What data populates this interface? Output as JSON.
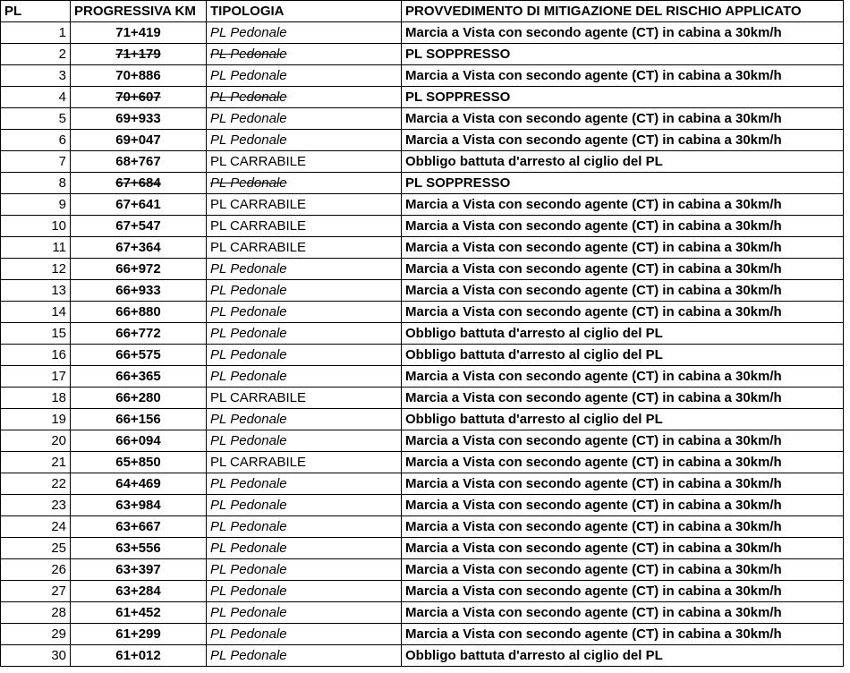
{
  "headers": {
    "pl": "PL",
    "km": "PROGRESSIVA KM",
    "tipologia": "TIPOLOGIA",
    "provvedimento": "PROVVEDIMENTO DI MITIGAZIONE DEL RISCHIO APPLICATO"
  },
  "colors": {
    "marcia": "#4472c4",
    "obbligo": "#ff0000",
    "soppresso": "#00a14b"
  },
  "rows": [
    {
      "pl": "1",
      "km": "71+419",
      "tip": "PL  Pedonale",
      "prov": "Marcia a Vista con secondo agente (CT) in cabina a 30km/h",
      "status": "marcia"
    },
    {
      "pl": "2",
      "km": "71+179",
      "tip": "PL  Pedonale",
      "prov": "PL  SOPPRESSO",
      "status": "soppresso"
    },
    {
      "pl": "3",
      "km": "70+886",
      "tip": "PL  Pedonale",
      "prov": "Marcia a Vista con secondo agente (CT) in cabina a 30km/h",
      "status": "marcia"
    },
    {
      "pl": "4",
      "km": "70+607",
      "tip": "PL  Pedonale",
      "prov": "PL  SOPPRESSO",
      "status": "soppresso"
    },
    {
      "pl": "5",
      "km": "69+933",
      "tip": "PL  Pedonale",
      "prov": "Marcia a Vista con secondo agente (CT) in cabina a 30km/h",
      "status": "marcia"
    },
    {
      "pl": "6",
      "km": "69+047",
      "tip": "PL  Pedonale",
      "prov": "Marcia a Vista con secondo agente (CT) in cabina a 30km/h",
      "status": "marcia"
    },
    {
      "pl": "7",
      "km": "68+767",
      "tip": "PL  CARRABILE",
      "prov": "Obbligo battuta d'arresto al ciglio del PL",
      "status": "obbligo"
    },
    {
      "pl": "8",
      "km": "67+684",
      "tip": "PL  Pedonale",
      "prov": "PL  SOPPRESSO",
      "status": "soppresso"
    },
    {
      "pl": "9",
      "km": "67+641",
      "tip": "PL  CARRABILE",
      "prov": "Marcia a Vista con secondo agente (CT) in cabina a 30km/h",
      "status": "marcia"
    },
    {
      "pl": "10",
      "km": "67+547",
      "tip": "PL  CARRABILE",
      "prov": "Marcia a Vista con secondo agente (CT) in cabina a 30km/h",
      "status": "marcia"
    },
    {
      "pl": "11",
      "km": "67+364",
      "tip": "PL  CARRABILE",
      "prov": "Marcia a Vista con secondo agente (CT) in cabina a 30km/h",
      "status": "marcia"
    },
    {
      "pl": "12",
      "km": "66+972",
      "tip": "PL  Pedonale",
      "prov": "Marcia a Vista con secondo agente (CT) in cabina a 30km/h",
      "status": "marcia"
    },
    {
      "pl": "13",
      "km": "66+933",
      "tip": "PL  Pedonale",
      "prov": "Marcia a Vista con secondo agente (CT) in cabina a 30km/h",
      "status": "marcia"
    },
    {
      "pl": "14",
      "km": "66+880",
      "tip": "PL  Pedonale",
      "prov": "Marcia a Vista con secondo agente (CT) in cabina a 30km/h",
      "status": "marcia"
    },
    {
      "pl": "15",
      "km": "66+772",
      "tip": "PL  Pedonale",
      "prov": "Obbligo battuta d'arresto al ciglio del PL",
      "status": "obbligo"
    },
    {
      "pl": "16",
      "km": "66+575",
      "tip": "PL  Pedonale",
      "prov": "Obbligo battuta d'arresto al ciglio del PL",
      "status": "obbligo"
    },
    {
      "pl": "17",
      "km": "66+365",
      "tip": "PL  Pedonale",
      "prov": "Marcia a Vista con secondo agente (CT) in cabina a 30km/h",
      "status": "marcia"
    },
    {
      "pl": "18",
      "km": "66+280",
      "tip": "PL  CARRABILE",
      "prov": "Marcia a Vista con secondo agente (CT) in cabina a 30km/h",
      "status": "marcia"
    },
    {
      "pl": "19",
      "km": "66+156",
      "tip": "PL  Pedonale",
      "prov": "Obbligo battuta d'arresto al ciglio del PL",
      "status": "obbligo"
    },
    {
      "pl": "20",
      "km": "66+094",
      "tip": "PL  Pedonale",
      "prov": "Marcia a Vista con secondo agente (CT) in cabina a 30km/h",
      "status": "marcia"
    },
    {
      "pl": "21",
      "km": "65+850",
      "tip": "PL  CARRABILE",
      "prov": "Marcia a Vista con secondo agente (CT) in cabina a 30km/h",
      "status": "marcia"
    },
    {
      "pl": "22",
      "km": "64+469",
      "tip": "PL  Pedonale",
      "prov": "Marcia a Vista con secondo agente (CT) in cabina a 30km/h",
      "status": "marcia"
    },
    {
      "pl": "23",
      "km": "63+984",
      "tip": "PL  Pedonale",
      "prov": "Marcia a Vista con secondo agente (CT) in cabina a 30km/h",
      "status": "marcia"
    },
    {
      "pl": "24",
      "km": "63+667",
      "tip": "PL  Pedonale",
      "prov": "Marcia a Vista con secondo agente (CT) in cabina a 30km/h",
      "status": "marcia"
    },
    {
      "pl": "25",
      "km": "63+556",
      "tip": "PL  Pedonale",
      "prov": "Marcia a Vista con secondo agente (CT) in cabina a 30km/h",
      "status": "marcia"
    },
    {
      "pl": "26",
      "km": "63+397",
      "tip": "PL  Pedonale",
      "prov": "Marcia a Vista con secondo agente (CT) in cabina a 30km/h",
      "status": "marcia"
    },
    {
      "pl": "27",
      "km": "63+284",
      "tip": "PL  Pedonale",
      "prov": "Marcia a Vista con secondo agente (CT) in cabina a 30km/h",
      "status": "marcia"
    },
    {
      "pl": "28",
      "km": "61+452",
      "tip": "PL  Pedonale",
      "prov": "Marcia a Vista con secondo agente (CT) in cabina a 30km/h",
      "status": "marcia"
    },
    {
      "pl": "29",
      "km": "61+299",
      "tip": "PL  Pedonale",
      "prov": "Marcia a Vista con secondo agente (CT) in cabina a 30km/h",
      "status": "marcia"
    },
    {
      "pl": "30",
      "km": "61+012",
      "tip": "PL  Pedonale",
      "prov": "Obbligo battuta d'arresto al ciglio del PL",
      "status": "obbligo"
    }
  ]
}
